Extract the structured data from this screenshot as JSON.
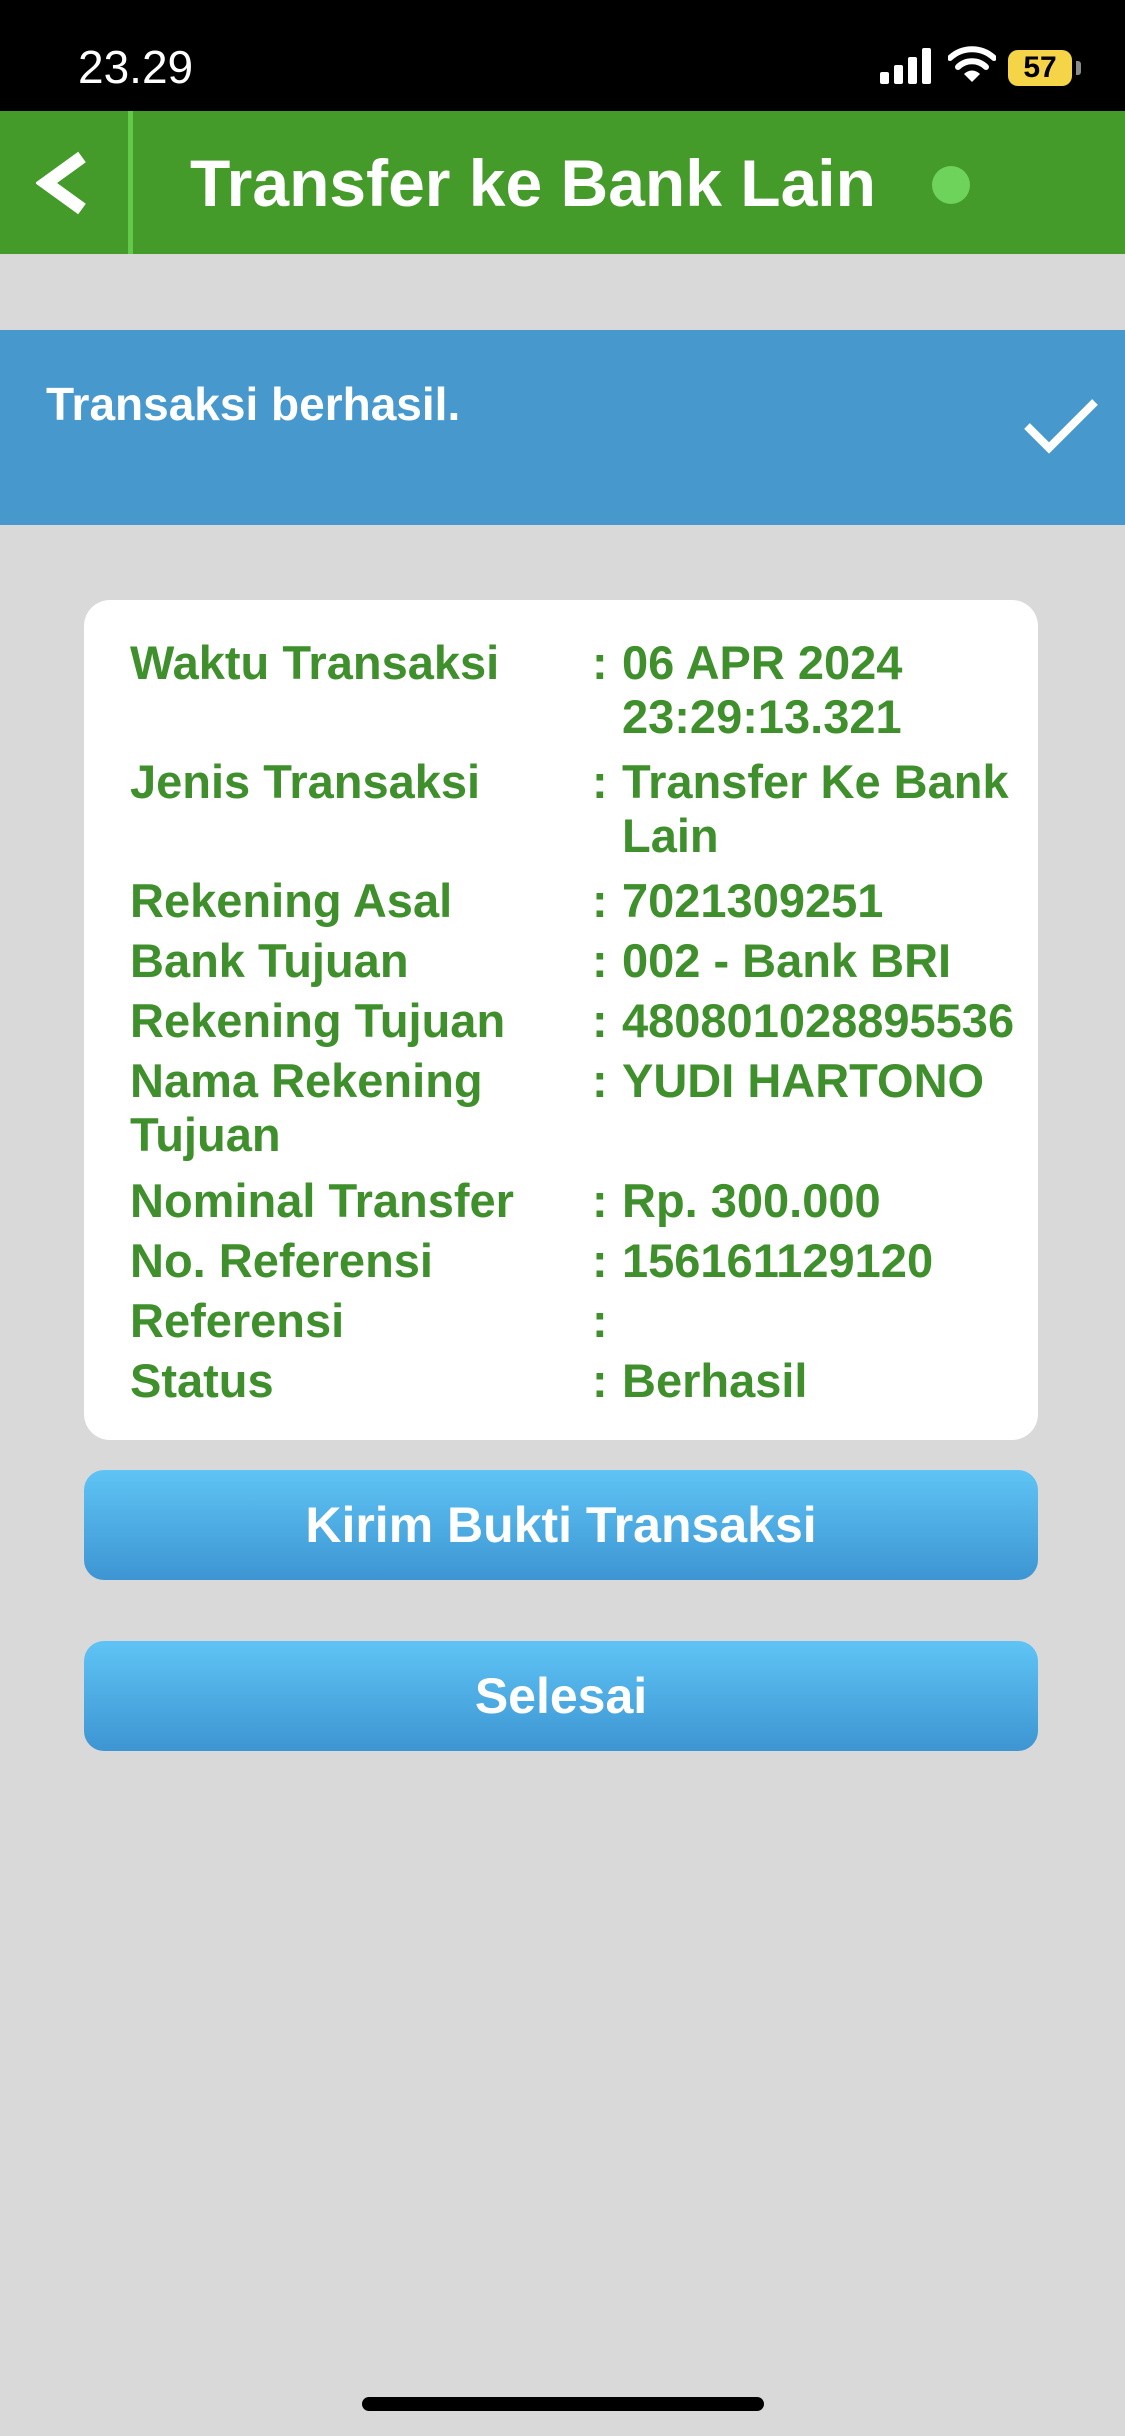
{
  "status_bar": {
    "time": "23.29",
    "battery_level": "57"
  },
  "header": {
    "title": "Transfer ke Bank Lain"
  },
  "banner": {
    "message": "Transaksi berhasil."
  },
  "details": {
    "separator": ":",
    "rows": [
      {
        "label": "Waktu Transaksi",
        "value": "06 APR 2024 23:29:13.321"
      },
      {
        "label": "Jenis Transaksi",
        "value": "Transfer Ke Bank Lain"
      },
      {
        "label": "Rekening Asal",
        "value": "7021309251"
      },
      {
        "label": "Bank Tujuan",
        "value": "002 - Bank BRI"
      },
      {
        "label": "Rekening Tujuan",
        "value": "480801028895536"
      },
      {
        "label": "Nama Rekening Tujuan",
        "value": "YUDI HARTONO"
      },
      {
        "label": "Nominal Transfer",
        "value": "Rp. 300.000"
      },
      {
        "label": "No. Referensi",
        "value": "156161129120"
      },
      {
        "label": "Referensi",
        "value": ""
      },
      {
        "label": "Status",
        "value": "Berhasil"
      }
    ]
  },
  "buttons": {
    "send_receipt": "Kirim Bukti Transaksi",
    "done": "Selesai"
  },
  "colors": {
    "header_green": "#459b2a",
    "banner_blue": "#4798cc",
    "text_green": "#3f8f2c",
    "button_blue": "#4aa8e0"
  },
  "icons": {
    "back": "chevron-left-icon",
    "success": "check-icon",
    "signal": "signal-icon",
    "wifi": "wifi-icon"
  }
}
